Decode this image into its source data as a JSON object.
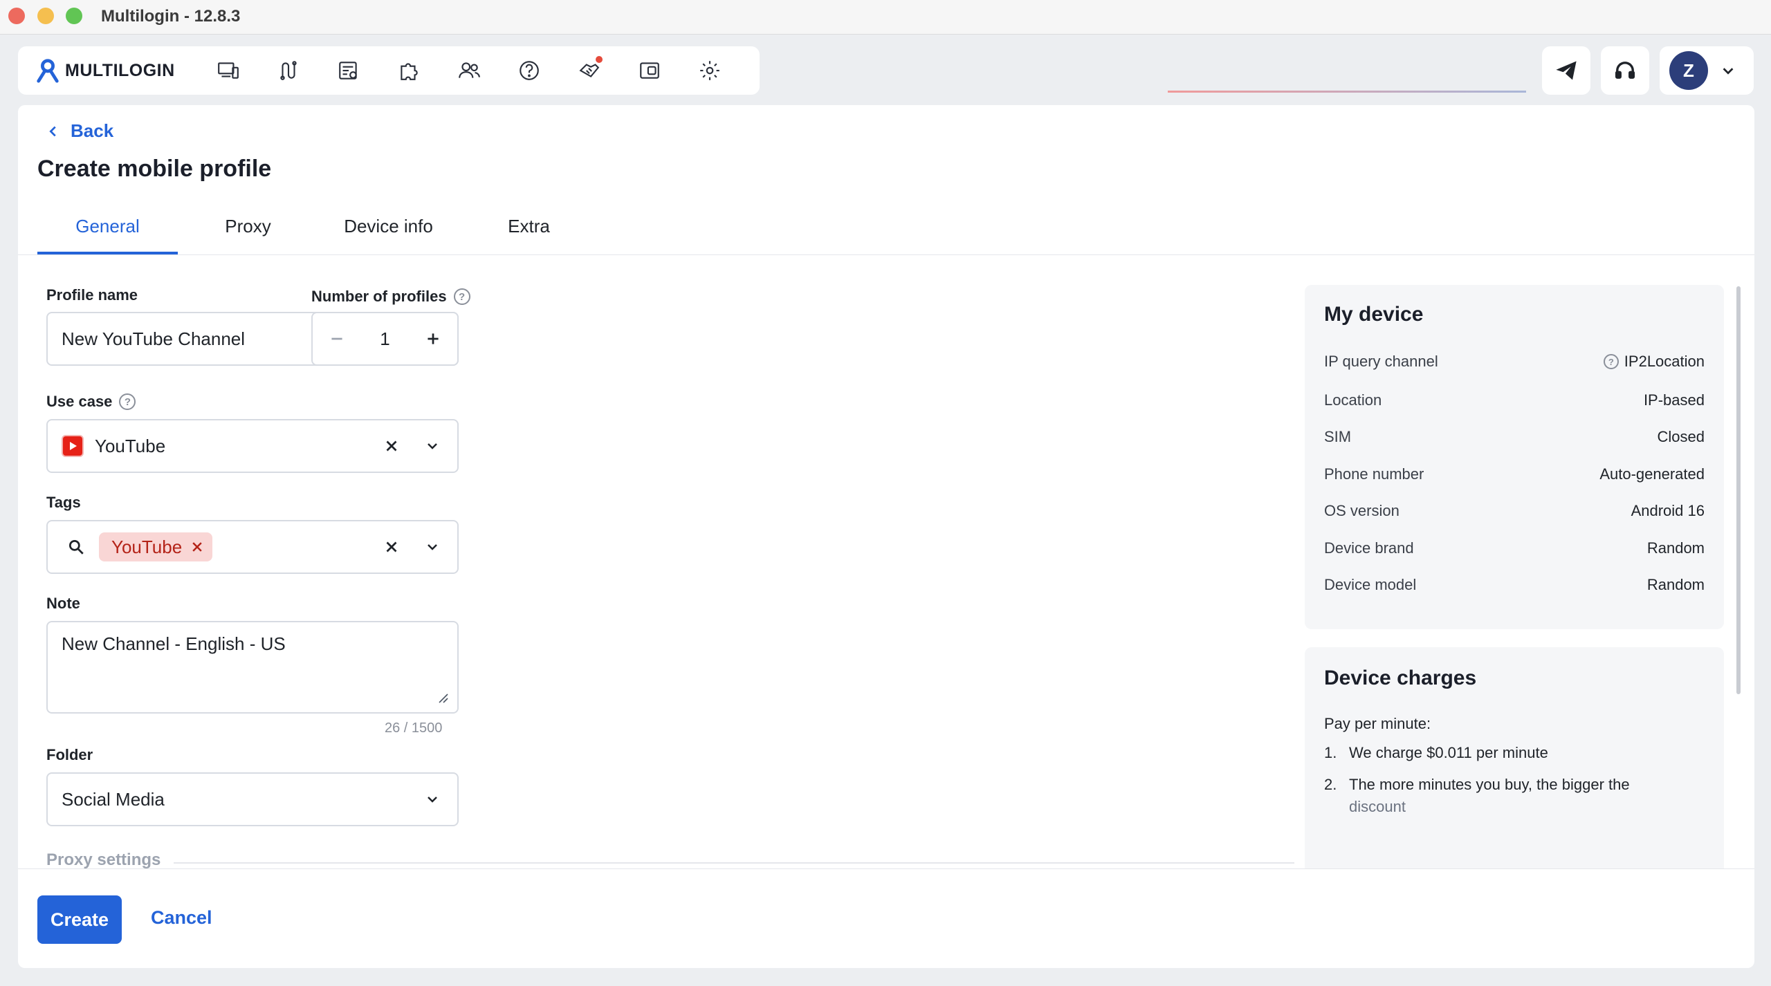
{
  "window": {
    "title": "Multilogin - 12.8.3"
  },
  "nav": {
    "logo_text": "MULTILOGIN",
    "icons": [
      "devices-icon",
      "automation-icon",
      "profiles-list-icon",
      "extensions-icon",
      "team-icon",
      "help-icon",
      "partner-icon",
      "wallet-icon",
      "settings-icon"
    ]
  },
  "user": {
    "avatar_initial": "Z"
  },
  "page": {
    "back_label": "Back",
    "title": "Create mobile profile",
    "tabs": [
      "General",
      "Proxy",
      "Device info",
      "Extra"
    ],
    "active_tab": "General"
  },
  "form": {
    "profile_name_label": "Profile name",
    "profile_name_value": "New YouTube Channel",
    "num_profiles_label": "Number of profiles",
    "num_profiles_value": "1",
    "use_case_label": "Use case",
    "use_case_value": "YouTube",
    "tags_label": "Tags",
    "tags": [
      "YouTube"
    ],
    "note_label": "Note",
    "note_value": "New Channel - English - US",
    "note_counter": "26 / 1500",
    "folder_label": "Folder",
    "folder_value": "Social Media",
    "proxy_section_label": "Proxy settings"
  },
  "my_device": {
    "title": "My device",
    "rows": [
      {
        "label": "IP query channel",
        "value": "IP2Location"
      },
      {
        "label": "Location",
        "value": "IP-based"
      },
      {
        "label": "SIM",
        "value": "Closed"
      },
      {
        "label": "Phone number",
        "value": "Auto-generated"
      },
      {
        "label": "OS version",
        "value": "Android 16"
      },
      {
        "label": "Device brand",
        "value": "Random"
      },
      {
        "label": "Device model",
        "value": "Random"
      }
    ]
  },
  "charges": {
    "title": "Device charges",
    "intro": "Pay per minute:",
    "items": [
      {
        "num": "1.",
        "text": "We charge $0.011 per minute"
      },
      {
        "num": "2.",
        "text": "The more minutes you buy, the bigger the",
        "text2": "discount"
      }
    ]
  },
  "footer": {
    "create_label": "Create",
    "cancel_label": "Cancel"
  },
  "colors": {
    "accent": "#2463d8",
    "tag_bg": "#f9d6d5",
    "tag_text": "#b42318",
    "youtube_red": "#e62117"
  }
}
